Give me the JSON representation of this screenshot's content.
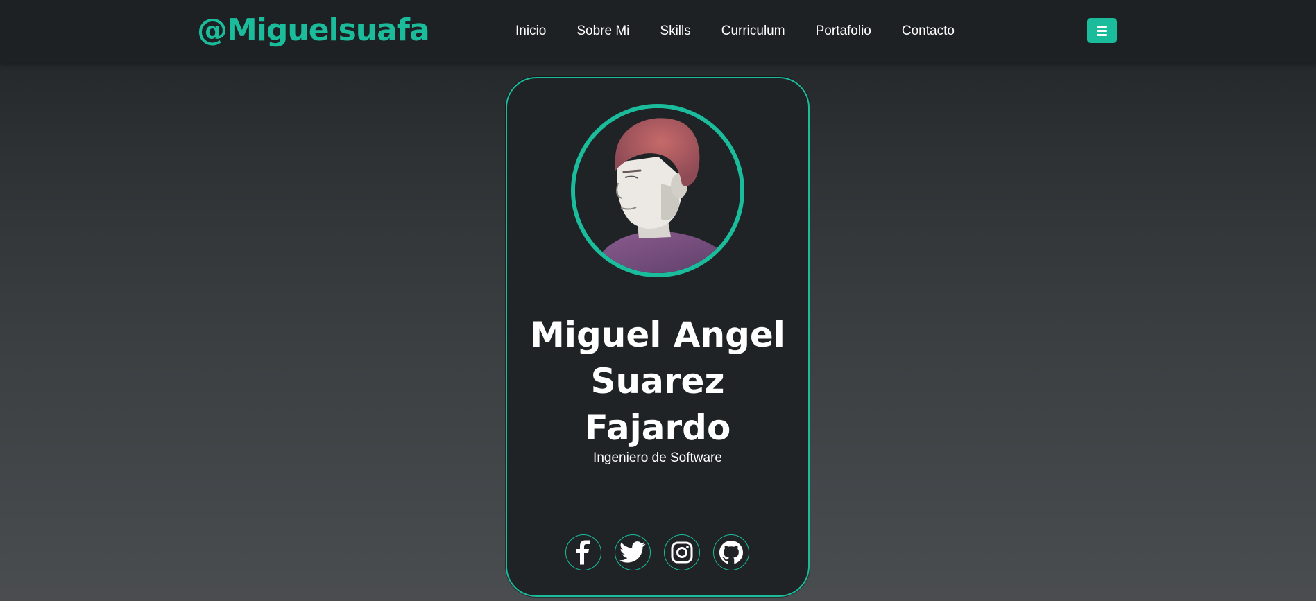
{
  "header": {
    "brand": "@Miguelsuafa",
    "nav": [
      {
        "label": "Inicio"
      },
      {
        "label": "Sobre Mi"
      },
      {
        "label": "Skills"
      },
      {
        "label": "Curriculum"
      },
      {
        "label": "Portafolio"
      },
      {
        "label": "Contacto"
      }
    ],
    "menu_icon": "hamburger-icon"
  },
  "profile": {
    "name_lines": [
      "Miguel Angel",
      "Suarez",
      "Fajardo"
    ],
    "role": "Ingeniero de Software",
    "socials": [
      {
        "icon": "facebook-icon"
      },
      {
        "icon": "twitter-icon"
      },
      {
        "icon": "instagram-icon"
      },
      {
        "icon": "github-icon"
      }
    ]
  },
  "colors": {
    "accent": "#1abc9c",
    "card_bg": "#1f2325",
    "nav_bg": "#1e2123",
    "text": "#ffffff"
  }
}
